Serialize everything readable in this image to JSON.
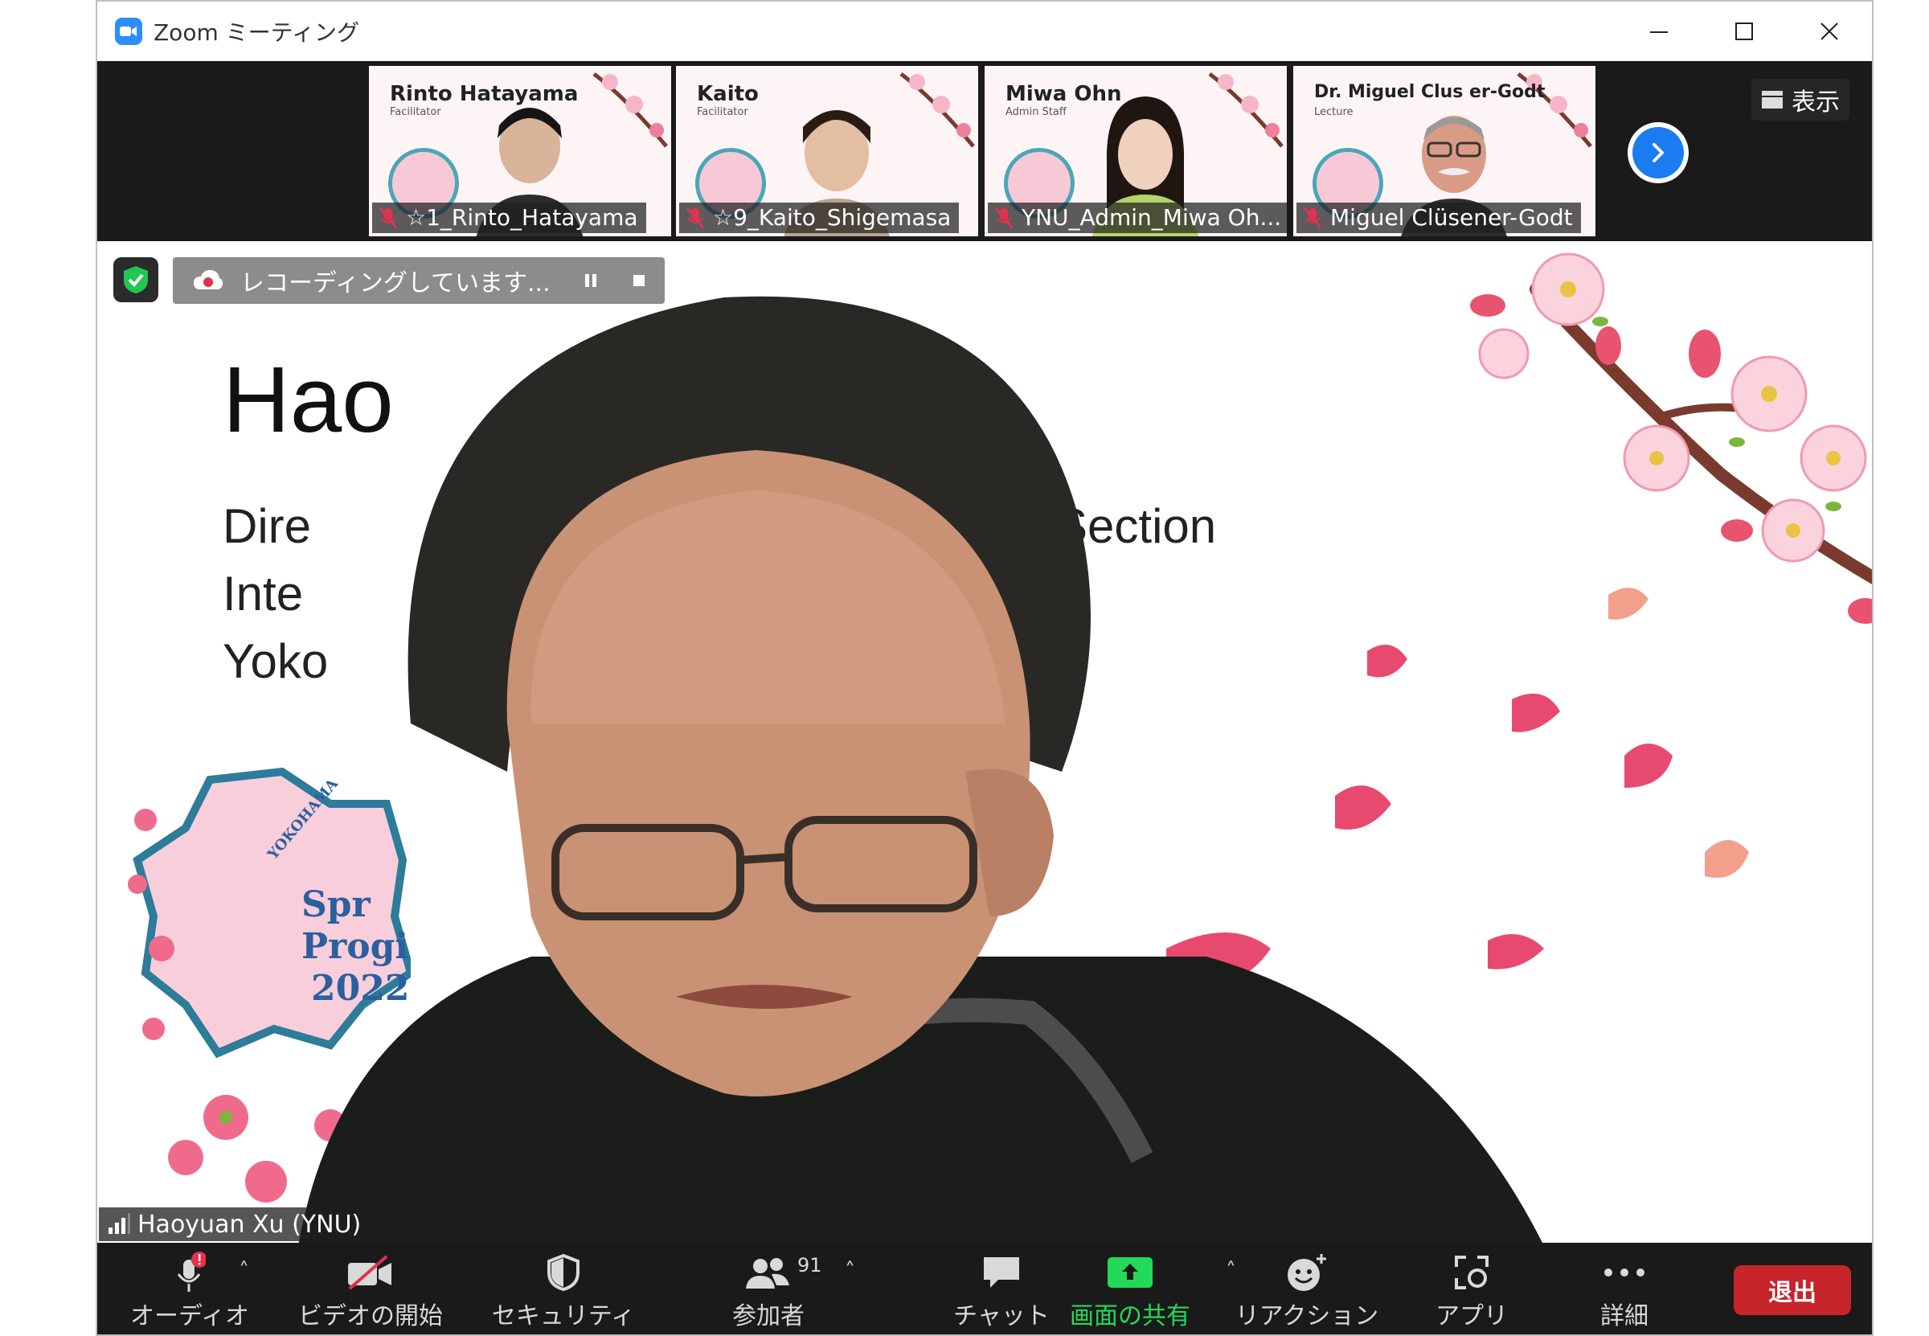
{
  "window": {
    "title": "Zoom ミーティング"
  },
  "thumbnails": [
    {
      "slide_name": "Rinto Hatayama",
      "slide_role": "Facilitator",
      "label": "☆1_Rinto_Hatayama"
    },
    {
      "slide_name": "Kaito",
      "slide_role": "Facilitator",
      "label": "☆9_Kaito_Shigemasa"
    },
    {
      "slide_name": "Miwa Ohn",
      "slide_role": "Admin Staff",
      "label": "YNU_Admin_Miwa Oh..."
    },
    {
      "slide_name": "Dr. Miguel Clus    er-Godt",
      "slide_role": "Lecture",
      "label": "Miguel Clüsener-Godt"
    }
  ],
  "view_button": {
    "label": "表示"
  },
  "recording": {
    "text": "レコーディングしています..."
  },
  "slide": {
    "title_fragment": "Hao",
    "line1_left": "Dire",
    "line1_right": "gy Section",
    "line2_left": "Inte",
    "line3_left": "Yoko",
    "badge_lines": [
      "Spr",
      "Progi",
      "2022"
    ],
    "badge_arc": "YOKOHAMA"
  },
  "speaker": {
    "name": "Haoyuan Xu (YNU)"
  },
  "toolbar": {
    "audio": "オーディオ",
    "video": "ビデオの開始",
    "security": "セキュリティ",
    "participants": "参加者",
    "participants_count": "91",
    "chat": "チャット",
    "share": "画面の共有",
    "reactions": "リアクション",
    "apps": "アプリ",
    "more": "詳細",
    "leave": "退出"
  },
  "colors": {
    "zoom_blue": "#2d8cff",
    "share_green": "#23d959",
    "leave_red": "#c8242b",
    "toolbar_bg": "#1a1a1a",
    "sakura_pink": "#e84a6f"
  }
}
